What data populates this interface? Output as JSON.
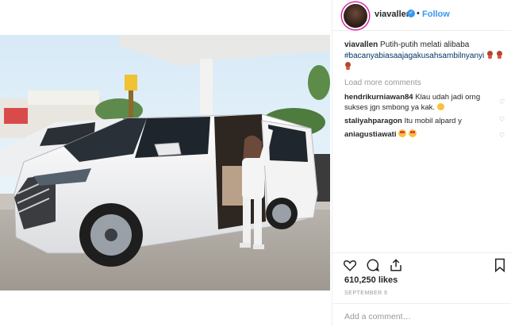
{
  "post": {
    "username": "viavallen",
    "follow_label": "Follow",
    "header_separator": "•",
    "caption": {
      "username": "viavallen",
      "text": "Putih-putih melati alibaba",
      "hashtag": "#bacanyabiasaajagakusahsambilnyanyi"
    },
    "load_more_label": "Load more comments",
    "comments": [
      {
        "username": "hendrikurniawan84",
        "text": "Klau udah jadi orng sukses jgn smbong ya kak."
      },
      {
        "username": "staliyahparagon",
        "text": "Itu mobil alpard y"
      },
      {
        "username": "aniagustiawati",
        "text": ""
      }
    ],
    "likes_label": "610,250 likes",
    "date_label": "SEPTEMBER 6",
    "add_comment_placeholder": "Add a comment…"
  },
  "icons": {
    "like": "heart-icon",
    "comment": "comment-icon",
    "share": "share-icon",
    "save": "bookmark-icon",
    "verified": "verified-badge-icon"
  },
  "colors": {
    "link_blue": "#3897f0",
    "hashtag": "#003569",
    "muted": "#999999",
    "text": "#262626",
    "border": "#efefef"
  }
}
